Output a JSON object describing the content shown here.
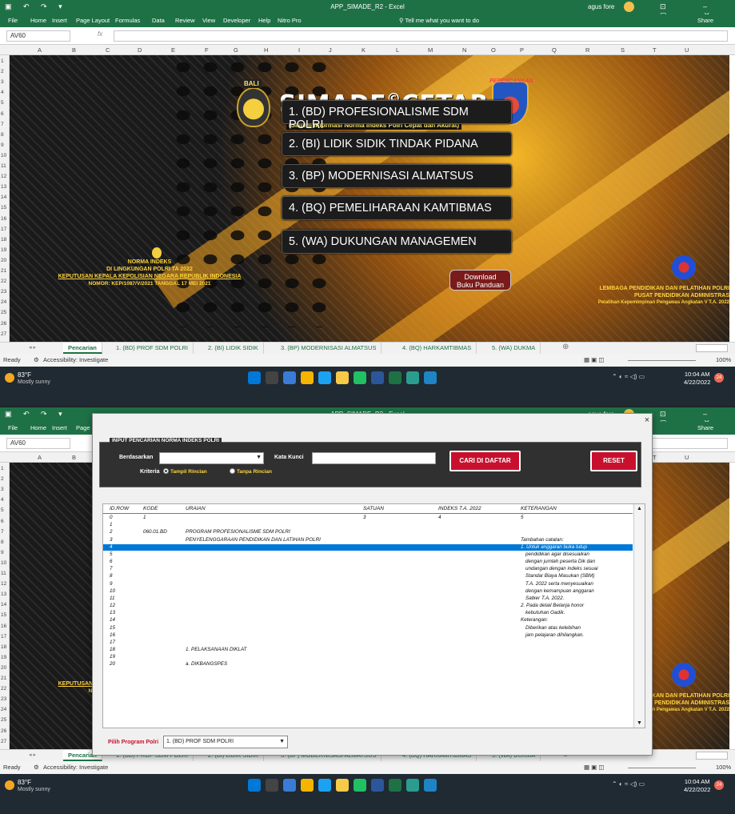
{
  "window": {
    "title": "APP_SIMADE_R2  -  Excel",
    "user": "agus fore"
  },
  "ribbon": {
    "tabs": [
      "File",
      "Home",
      "Insert",
      "Page Layout",
      "Formulas",
      "Data",
      "Review",
      "View",
      "Developer",
      "Help",
      "Nitro Pro"
    ],
    "tell_me": "Tell me what you want to do",
    "share": "Share"
  },
  "formula": {
    "name_box": "AV60",
    "fx": "fx"
  },
  "columns": [
    "A",
    "B",
    "C",
    "D",
    "E",
    "F",
    "G",
    "H",
    "I",
    "J",
    "K",
    "L",
    "M",
    "N",
    "O",
    "P",
    "Q",
    "R",
    "S",
    "T",
    "U"
  ],
  "rows": [
    "1",
    "2",
    "3",
    "4",
    "5",
    "6",
    "7",
    "8",
    "9",
    "10",
    "11",
    "12",
    "13",
    "14",
    "15",
    "16",
    "17",
    "18",
    "19",
    "20",
    "21",
    "22",
    "23",
    "24",
    "25",
    "26",
    "27"
  ],
  "app": {
    "badge": "BALI",
    "title": "SIMADE",
    "title_mark": "©",
    "title2": "CETAR",
    "subtitle": "(Sistem Informasi Norma Indeks Polri Cepat dan Akurat)",
    "right_logo_text": "PERENCANAAN",
    "menu": [
      "1. (BD) PROFESIONALISME SDM POLRI",
      "2. (BI) LIDIK SIDIK TINDAK PIDANA",
      "3. (BP) MODERNISASI ALMATSUS",
      "4. (BQ) PEMELIHARAAN KAMTIBMAS",
      "5. (WA) DUKUNGAN MANAGEMEN"
    ],
    "download": [
      "Download",
      "Buku Panduan"
    ],
    "norma": [
      "NORMA INDEKS",
      "DI LINGKUNGAN POLRI TA 2022",
      "KEPUTUSAN KEPALA KEPOLISIAN NEGARA REPUBLIK INDONESIA",
      "NOMOR: KEP/1087/V/2021 TANGGAL 17 MEI 2021"
    ],
    "lembaga": [
      "LEMBAGA PENDIDIKAN DAN PELATIHAN POLRI",
      "PUSAT PENDIDIKAN ADMINISTRAS",
      "Pelatihan Kepemimpinan Pengawas Angkatan V T.A. 2022"
    ]
  },
  "sheet_tabs": [
    "Pencarian",
    "1. (BD) PROF SDM POLRI",
    "2. (BI) LIDIK SIDIK",
    "3. (BP) MODERNISASI ALMATSUS",
    "4. (BQ) HARKAMTIBMAS",
    "5. (WA) DUKMA"
  ],
  "status": {
    "ready": "Ready",
    "accessibility": "Accessibility: Investigate",
    "zoom": "100%"
  },
  "taskbar": {
    "temp": "83°F",
    "weather": "Mostly sunny",
    "time": "10:04 AM",
    "date": "4/22/2022",
    "notifications": "24"
  },
  "dialog": {
    "close": "×",
    "panel_title": "INPUT PENCARIAN NORMA INDEKS POLRI",
    "berdasarkan_label": "Berdasarkan",
    "berdasarkan_value": "",
    "kata_kunci_label": "Kata Kunci",
    "kata_kunci_value": "",
    "kriteria_label": "Kriteria",
    "radio_on": "Tampil Rincian",
    "radio_off": "Tanpa Rincian",
    "search_btn": "CARI DI DAFTAR",
    "reset_btn": "RESET",
    "headers": [
      "ID.ROW",
      "KODE",
      "URAIAN",
      "SATUAN",
      "INDEKS T.A. 2022",
      "KETERANGAN"
    ],
    "rows": [
      {
        "id": "0",
        "kode": "1",
        "uraian": "",
        "satuan": "3",
        "indeks": "4",
        "ket": "5"
      },
      {
        "id": "1",
        "kode": "",
        "uraian": "",
        "satuan": "",
        "indeks": "",
        "ket": ""
      },
      {
        "id": "2",
        "kode": "060.01.BD",
        "uraian": "PROGRAM PROFESIONALISME SDM POLRI",
        "satuan": "",
        "indeks": "",
        "ket": ""
      },
      {
        "id": "3",
        "kode": "",
        "uraian": "PENYELENGGARAAN PENDIDIKAN DAN LATIHAN POLRI",
        "satuan": "",
        "indeks": "",
        "ket": "Tambahan catatan:"
      },
      {
        "id": "4",
        "kode": "",
        "uraian": "",
        "satuan": "",
        "indeks": "",
        "ket": "1. Untuk anggaran buka tutup",
        "sel": true
      },
      {
        "id": "5",
        "kode": "",
        "uraian": "",
        "satuan": "",
        "indeks": "",
        "ket": "pendidikan agar disesuaikan"
      },
      {
        "id": "6",
        "kode": "",
        "uraian": "",
        "satuan": "",
        "indeks": "",
        "ket": "dengan jumlah peserta Dik dan"
      },
      {
        "id": "7",
        "kode": "",
        "uraian": "",
        "satuan": "",
        "indeks": "",
        "ket": "undangan dengan indeks sesuai"
      },
      {
        "id": "8",
        "kode": "",
        "uraian": "",
        "satuan": "",
        "indeks": "",
        "ket": "Standar Biaya Masukan (SBM)"
      },
      {
        "id": "9",
        "kode": "",
        "uraian": "",
        "satuan": "",
        "indeks": "",
        "ket": "T.A. 2022 serta menyesuaikan"
      },
      {
        "id": "10",
        "kode": "",
        "uraian": "",
        "satuan": "",
        "indeks": "",
        "ket": "dengan kemampuan anggaran"
      },
      {
        "id": "11",
        "kode": "",
        "uraian": "",
        "satuan": "",
        "indeks": "",
        "ket": "Satker T.A. 2022."
      },
      {
        "id": "12",
        "kode": "",
        "uraian": "",
        "satuan": "",
        "indeks": "",
        "ket": "2. Pada detail Belanja honor"
      },
      {
        "id": "13",
        "kode": "",
        "uraian": "",
        "satuan": "",
        "indeks": "",
        "ket": "kebutuhan Gadik."
      },
      {
        "id": "14",
        "kode": "",
        "uraian": "",
        "satuan": "",
        "indeks": "",
        "ket": "Keterangan:"
      },
      {
        "id": "15",
        "kode": "",
        "uraian": "",
        "satuan": "",
        "indeks": "",
        "ket": "Diberikan atas kelebihan"
      },
      {
        "id": "16",
        "kode": "",
        "uraian": "",
        "satuan": "",
        "indeks": "",
        "ket": "jam pelajaran dihilangkan."
      },
      {
        "id": "17",
        "kode": "",
        "uraian": "",
        "satuan": "",
        "indeks": "",
        "ket": ""
      },
      {
        "id": "18",
        "kode": "",
        "uraian": "1. PELAKSANAAN DIKLAT",
        "satuan": "",
        "indeks": "",
        "ket": ""
      },
      {
        "id": "19",
        "kode": "",
        "uraian": "",
        "satuan": "",
        "indeks": "",
        "ket": ""
      },
      {
        "id": "20",
        "kode": "",
        "uraian": "a. DIKBANGSPES",
        "satuan": "",
        "indeks": "",
        "ket": ""
      }
    ],
    "program_label": "Pilih Program Polri",
    "program_value": "1. (BD) PROF SDM POLRI"
  }
}
